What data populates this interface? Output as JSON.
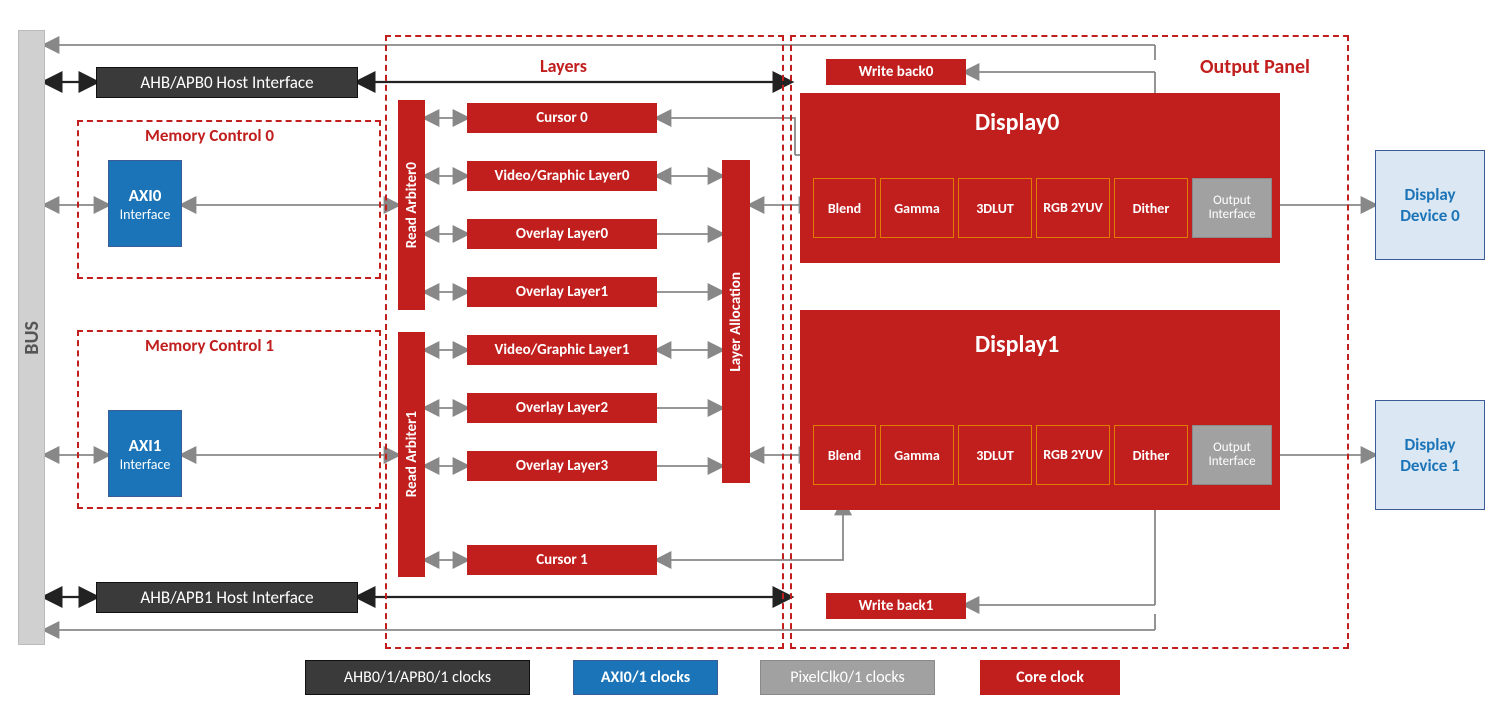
{
  "bus": "BUS",
  "host0": "AHB/APB0 Host Interface",
  "host1": "AHB/APB1 Host Interface",
  "memctrl0": {
    "title": "Memory Control 0",
    "axi": "AXI0",
    "sub": "Interface"
  },
  "memctrl1": {
    "title": "Memory Control 1",
    "axi": "AXI1",
    "sub": "Interface"
  },
  "layers_title": "Layers",
  "read_arbiter0": "Read Arbiter0",
  "read_arbiter1": "Read Arbiter1",
  "layer_alloc": "Layer Allocation",
  "layer_items": {
    "cursor0": "Cursor 0",
    "vg0": "Video/Graphic Layer0",
    "ov0": "Overlay Layer0",
    "ov1": "Overlay Layer1",
    "vg1": "Video/Graphic Layer1",
    "ov2": "Overlay Layer2",
    "ov3": "Overlay Layer3",
    "cursor1": "Cursor 1"
  },
  "output_panel_title": "Output Panel",
  "writeback0": "Write back0",
  "writeback1": "Write back1",
  "display0": {
    "title": "Display0"
  },
  "display1": {
    "title": "Display1"
  },
  "pipe": {
    "blend": "Blend",
    "gamma": "Gamma",
    "lut": "3DLUT",
    "rgb2yuv": "RGB 2YUV",
    "dither": "Dither",
    "out": "Output Interface"
  },
  "device0": {
    "l1": "Display",
    "l2": "Device 0"
  },
  "device1": {
    "l1": "Display",
    "l2": "Device 1"
  },
  "legend": {
    "ahb": "AHB0/1/APB0/1 clocks",
    "axi": "AXI0/1 clocks",
    "pix": "PixelClk0/1 clocks",
    "core": "Core clock"
  }
}
